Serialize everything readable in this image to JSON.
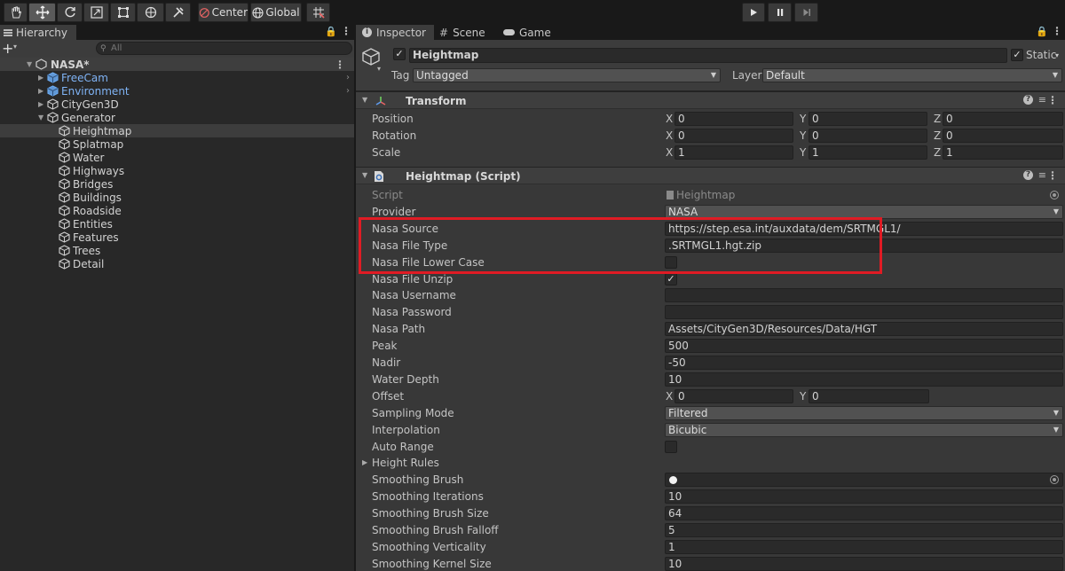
{
  "toolbar": {
    "center_label": "Center",
    "global_label": "Global"
  },
  "hierarchy": {
    "tab_label": "Hierarchy",
    "search_placeholder": "All",
    "scene_name": "NASA*",
    "items": [
      {
        "label": "FreeCam",
        "prefab": true,
        "expandable": true
      },
      {
        "label": "Environment",
        "prefab": true,
        "expandable": true
      },
      {
        "label": "CityGen3D",
        "prefab": false,
        "expandable": true
      },
      {
        "label": "Generator",
        "prefab": false,
        "expandable": true,
        "expanded": true
      },
      {
        "label": "Heightmap",
        "selected": true
      },
      {
        "label": "Splatmap"
      },
      {
        "label": "Water"
      },
      {
        "label": "Highways"
      },
      {
        "label": "Bridges"
      },
      {
        "label": "Buildings"
      },
      {
        "label": "Roadside"
      },
      {
        "label": "Entities"
      },
      {
        "label": "Features"
      },
      {
        "label": "Trees"
      },
      {
        "label": "Detail"
      }
    ]
  },
  "inspector": {
    "tabs": [
      "Inspector",
      "Scene",
      "Game"
    ],
    "object_name": "Heightmap",
    "static_label": "Static",
    "tag_label": "Tag",
    "tag_value": "Untagged",
    "layer_label": "Layer",
    "layer_value": "Default",
    "transform": {
      "title": "Transform",
      "position_label": "Position",
      "rotation_label": "Rotation",
      "scale_label": "Scale",
      "position": [
        "0",
        "0",
        "0"
      ],
      "rotation": [
        "0",
        "0",
        "0"
      ],
      "scale": [
        "1",
        "1",
        "1"
      ],
      "axes": [
        "X",
        "Y",
        "Z"
      ]
    },
    "script": {
      "title": "Heightmap (Script)",
      "script_label": "Script",
      "script_value": "Heightmap",
      "provider_label": "Provider",
      "provider_value": "NASA",
      "nasa_source_label": "Nasa Source",
      "nasa_source_value": "https://step.esa.int/auxdata/dem/SRTMGL1/",
      "nasa_file_type_label": "Nasa File Type",
      "nasa_file_type_value": ".SRTMGL1.hgt.zip",
      "nasa_lower_case_label": "Nasa File Lower Case",
      "nasa_unzip_label": "Nasa File Unzip",
      "nasa_username_label": "Nasa Username",
      "nasa_username_value": "",
      "nasa_password_label": "Nasa Password",
      "nasa_password_value": "",
      "nasa_path_label": "Nasa Path",
      "nasa_path_value": "Assets/CityGen3D/Resources/Data/HGT",
      "peak_label": "Peak",
      "peak_value": "500",
      "nadir_label": "Nadir",
      "nadir_value": "-50",
      "water_depth_label": "Water Depth",
      "water_depth_value": "10",
      "offset_label": "Offset",
      "offset_x": "0",
      "offset_y": "0",
      "sampling_mode_label": "Sampling Mode",
      "sampling_mode_value": "Filtered",
      "interpolation_label": "Interpolation",
      "interpolation_value": "Bicubic",
      "auto_range_label": "Auto Range",
      "height_rules_label": "Height Rules",
      "smoothing_brush_label": "Smoothing Brush",
      "smoothing_iterations_label": "Smoothing Iterations",
      "smoothing_iterations_value": "10",
      "smoothing_brush_size_label": "Smoothing Brush Size",
      "smoothing_brush_size_value": "64",
      "smoothing_brush_falloff_label": "Smoothing Brush Falloff",
      "smoothing_brush_falloff_value": "5",
      "smoothing_verticality_label": "Smoothing Verticality",
      "smoothing_verticality_value": "1",
      "smoothing_kernel_size_label": "Smoothing Kernel Size",
      "smoothing_kernel_size_value": "10"
    }
  },
  "colors": {
    "highlight": "#e01b24",
    "prefab_text": "#7fb3f5"
  }
}
